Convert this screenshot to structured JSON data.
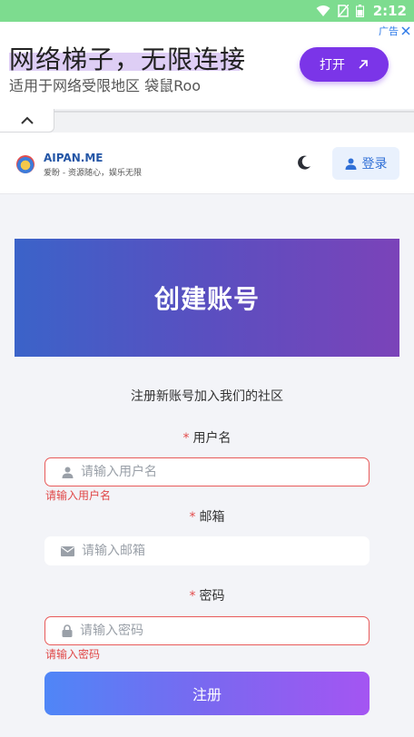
{
  "status_bar": {
    "time": "2:12"
  },
  "ad": {
    "title": "网络梯子，无限连接",
    "subtitle": "适用于网络受限地区 袋鼠Roo",
    "tag": "广告",
    "button": "打开"
  },
  "header": {
    "brand": "AIPAN.ME",
    "slogan": "爱盼 - 资源随心，娱乐无限",
    "login": "登录"
  },
  "hero": {
    "title": "创建账号"
  },
  "form": {
    "subtitle": "注册新账号加入我们的社区",
    "required_mark": "*",
    "username": {
      "label": "用户名",
      "placeholder": "请输入用户名",
      "error": "请输入用户名"
    },
    "email": {
      "label": "邮箱",
      "placeholder": "请输入邮箱"
    },
    "password": {
      "label": "密码",
      "placeholder": "请输入密码",
      "error": "请输入密码"
    },
    "submit": "注册"
  },
  "colors": {
    "accent": "#7b35e8",
    "error": "#e04848",
    "link": "#2f6fd6"
  }
}
